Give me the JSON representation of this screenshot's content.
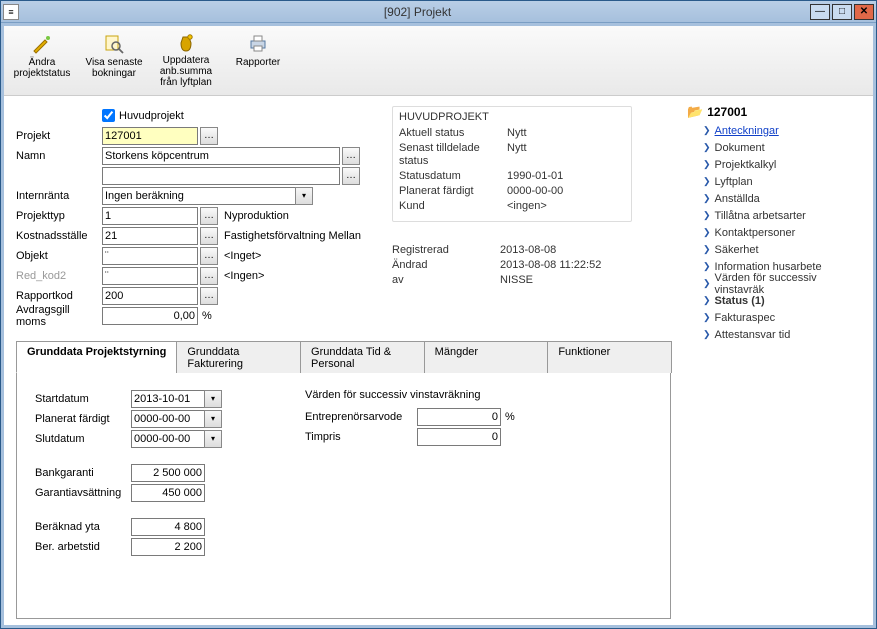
{
  "window": {
    "title": "[902]  Projekt"
  },
  "toolbar": {
    "change_status": "Ändra\nprojektstatus",
    "show_bookings": "Visa senaste\nbokningar",
    "update_sum": "Uppdatera\nanb.summa\nfrån lyftplan",
    "reports": "Rapporter"
  },
  "form": {
    "huvudprojekt_chk_label": "Huvudprojekt",
    "labels": {
      "projekt": "Projekt",
      "namn": "Namn",
      "internranta": "Internränta",
      "projekttyp": "Projekttyp",
      "kostnadsstalle": "Kostnadsställe",
      "objekt": "Objekt",
      "red_kod2": "Red_kod2",
      "rapportkod": "Rapportkod",
      "avdrag_moms": "Avdragsgill moms"
    },
    "values": {
      "projekt": "127001",
      "namn": "Storkens köpcentrum",
      "namn2": "",
      "internranta": "Ingen beräkning",
      "projekttyp": "1",
      "projekttyp_desc": "Nyproduktion",
      "kostnadsstalle": "21",
      "kostnadsstalle_desc": "Fastighetsförvaltning Mellan",
      "objekt": "¨",
      "objekt_desc": "<Inget>",
      "red_kod2": "¨",
      "red_kod2_desc": "<Ingen>",
      "rapportkod": "200",
      "avdrag_moms": "0,00",
      "avdrag_moms_unit": "%"
    }
  },
  "status": {
    "header": "HUVUDPROJEKT",
    "rows": {
      "aktuell_status_k": "Aktuell status",
      "aktuell_status_v": "Nytt",
      "senast_tilldelade_status_k": "Senast tilldelade status",
      "senast_tilldelade_status_v": "Nytt",
      "statusdatum_k": "Statusdatum",
      "statusdatum_v": "1990-01-01",
      "planerat_fardigt_k": "Planerat färdigt",
      "planerat_fardigt_v": "0000-00-00",
      "kund_k": "Kund",
      "kund_v": "<ingen>"
    }
  },
  "meta": {
    "registrerad_k": "Registrerad",
    "registrerad_v": "2013-08-08",
    "andrad_k": "Ändrad",
    "andrad_v": "2013-08-08 11:22:52",
    "av_k": "av",
    "av_v": "NISSE"
  },
  "tabs": {
    "t1": "Grunddata Projektstyrning",
    "t2": "Grunddata Fakturering",
    "t3": "Grunddata Tid & Personal",
    "t4": "Mängder",
    "t5": "Funktioner"
  },
  "tabbody": {
    "left": {
      "startdatum_k": "Startdatum",
      "startdatum_v": "2013-10-01",
      "planerat_fardigt_k": "Planerat färdigt",
      "planerat_fardigt_v": "0000-00-00",
      "slutdatum_k": "Slutdatum",
      "slutdatum_v": "0000-00-00",
      "bankgaranti_k": "Bankgaranti",
      "bankgaranti_v": "2 500 000",
      "garantianv_k": "Garantiavsättning",
      "garantianv_v": "450 000",
      "beraknad_yta_k": "Beräknad yta",
      "beraknad_yta_v": "4 800",
      "ber_arbetstid_k": "Ber. arbetstid",
      "ber_arbetstid_v": "2 200"
    },
    "right": {
      "header": "Värden för successiv vinstavräkning",
      "entrep_k": "Entreprenörsarvode",
      "entrep_v": "0",
      "entrep_unit": "%",
      "timpris_k": "Timpris",
      "timpris_v": "0"
    }
  },
  "tree": {
    "root": "127001",
    "items": [
      {
        "label": "Anteckningar",
        "link": true
      },
      {
        "label": "Dokument"
      },
      {
        "label": "Projektkalkyl"
      },
      {
        "label": "Lyftplan"
      },
      {
        "label": "Anställda"
      },
      {
        "label": "Tillåtna arbetsarter"
      },
      {
        "label": "Kontaktpersoner"
      },
      {
        "label": "Säkerhet"
      },
      {
        "label": "Information husarbete"
      },
      {
        "label": "Värden för successiv vinstavräk"
      },
      {
        "label": "Status (1)",
        "bold": true
      },
      {
        "label": "Fakturaspec"
      },
      {
        "label": "Attestansvar tid"
      }
    ]
  }
}
